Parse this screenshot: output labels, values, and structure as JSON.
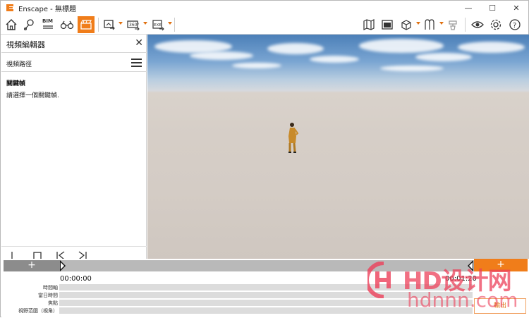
{
  "window": {
    "title": "Enscape - 無標題",
    "minimize": "—",
    "maximize": "☐",
    "close": "✕"
  },
  "toolbar": {
    "bim_label": "BIM",
    "icons": [
      "home-icon",
      "map-pin-icon",
      "bim-icon",
      "binoculars-icon",
      "video-editor-icon",
      "screenshot-icon",
      "panorama-360-icon",
      "export-exe-icon",
      "map-icon",
      "web-standalone-icon",
      "box-icon",
      "asset-library-icon",
      "material-icon",
      "view-icon",
      "settings-icon",
      "help-icon"
    ],
    "accent": "#f07d1a"
  },
  "panel": {
    "title": "視頻編輯器",
    "path_label": "視頻路徑",
    "keyframe_title": "關鍵幀",
    "keyframe_hint": "請選擇一個關鍵幀."
  },
  "timeline": {
    "add_left": "+",
    "add_right": "+",
    "time_start": "00:00:00",
    "time_end": "00:01:20",
    "properties": [
      "時間軸",
      "當日時間",
      "焦點",
      "視野范圍（視角）"
    ],
    "export_label": "輸出"
  },
  "watermark": {
    "brand": "HD设计网",
    "url": "hdnnn.com",
    "color": "#ec405a"
  }
}
